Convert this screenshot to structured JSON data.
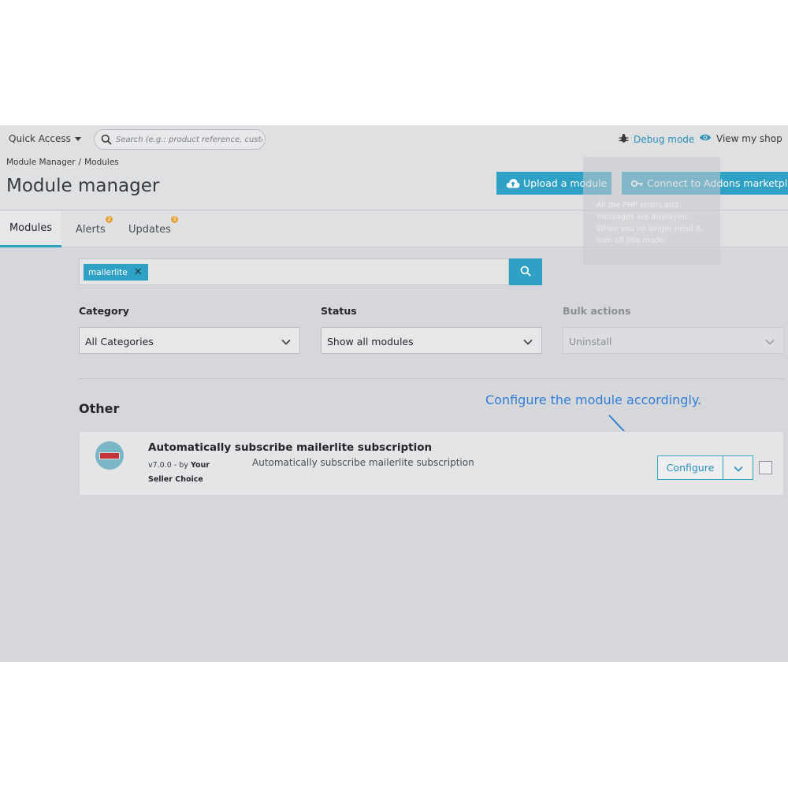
{
  "header": {
    "quick_access": "Quick Access",
    "search_placeholder": "Search (e.g.: product reference, customer name...)",
    "debug_mode": "Debug mode",
    "view_shop": "View my shop"
  },
  "breadcrumb": [
    "Module Manager",
    "Modules"
  ],
  "page_title": "Module manager",
  "actions": {
    "upload": "Upload a module",
    "connect": "Connect to Addons marketplace"
  },
  "debug_tooltip": {
    "lines": [
      "All the PHP errors and",
      "messages are displayed.",
      "When you no longer need it,",
      "turn off this mode."
    ]
  },
  "tabs": [
    {
      "label": "Modules",
      "active": true
    },
    {
      "label": "Alerts",
      "badge": "2"
    },
    {
      "label": "Updates",
      "badge": "3"
    }
  ],
  "filter": {
    "tag": "mailerlite"
  },
  "category": {
    "label": "Category",
    "value": "All Categories"
  },
  "status": {
    "label": "Status",
    "value": "Show all modules"
  },
  "bulk": {
    "label": "Bulk actions",
    "value": "Uninstall"
  },
  "section_title": "Other",
  "annotation": "Configure the module accordingly.",
  "module": {
    "name": "Automatically subscribe mailerlite subscription",
    "version_prefix": "v7.0.0 - by ",
    "author": "Your Seller Choice",
    "description": "Automatically subscribe mailerlite subscription",
    "configure": "Configure"
  },
  "colors": {
    "accent": "#2ea1c4",
    "annotation": "#2f7fd8",
    "badge": "#e2a53c"
  }
}
